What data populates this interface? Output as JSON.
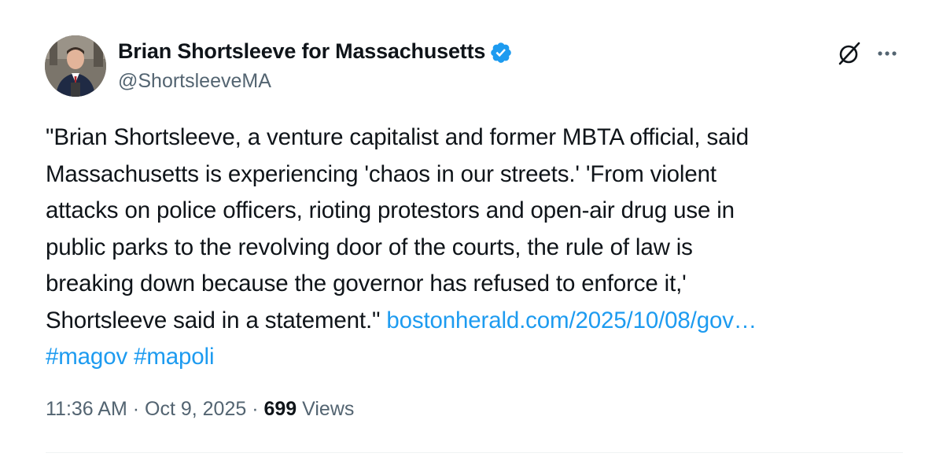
{
  "author": {
    "display_name": "Brian Shortsleeve for Massachusetts",
    "handle": "@ShortsleeveMA",
    "verified_color": "#1d9bf0",
    "avatar_icon": "profile-photo"
  },
  "actions": {
    "grok_icon": "grok-icon",
    "more_icon": "more-horizontal-icon"
  },
  "tweet": {
    "lines": [
      "\"Brian Shortsleeve, a venture capitalist and former MBTA official, said",
      "Massachusetts is experiencing 'chaos in our streets.' 'From violent",
      "attacks on police officers, rioting protestors and open-air drug use in",
      "public parks to the revolving door of the courts, the rule of law is",
      "breaking down because the governor has refused to enforce it,'",
      "Shortsleeve said in a statement.\" "
    ],
    "link_text": "bostonherald.com/2025/10/08/gov…",
    "hashtags": [
      "#magov",
      "#mapoli"
    ],
    "link_color": "#1d9bf0"
  },
  "meta": {
    "time": "11:36 AM",
    "separator": " · ",
    "date": "Oct 9, 2025",
    "views_count": "699",
    "views_label": " Views"
  }
}
